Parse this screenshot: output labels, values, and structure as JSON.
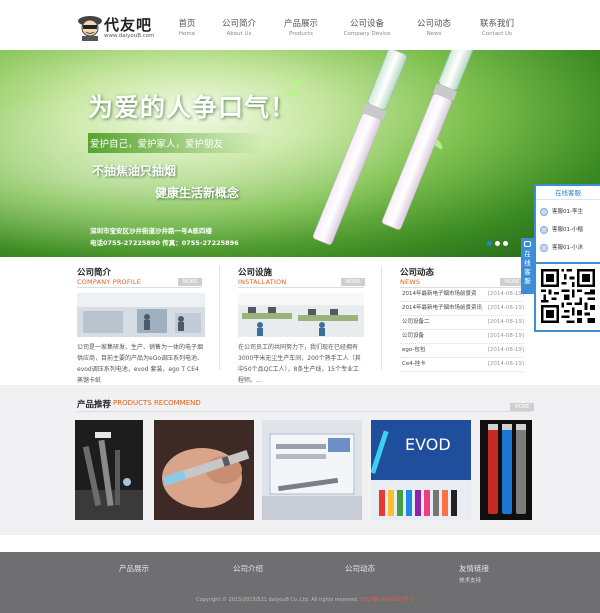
{
  "logo": {
    "name": "代友吧",
    "url": "www.daiyouB.com"
  },
  "nav": [
    {
      "cn": "首页",
      "en": "Home"
    },
    {
      "cn": "公司简介",
      "en": "About Us"
    },
    {
      "cn": "产品展示",
      "en": "Products"
    },
    {
      "cn": "公司设备",
      "en": "Company Device"
    },
    {
      "cn": "公司动态",
      "en": "News"
    },
    {
      "cn": "联系我们",
      "en": "Contact Us"
    }
  ],
  "banner": {
    "slogan": "为爱的人争口气！",
    "sub1": "爱护自己，爱护家人，爱护朋友",
    "sub2": "不抽焦油只抽烟",
    "sub3": "健康生活新概念",
    "address": "深圳市宝安区沙井街道沙井路一号A栋四楼",
    "phone": "电话0755-27225890  传真：0755-27225896"
  },
  "about": {
    "title": "公司简介",
    "subtitle": "COMPANY PROFILE",
    "more": "MORE",
    "text": "公司是一家集研发、生产、销售为一体的电子烟供应商，目前主要的产品为eGo调压系列电池、evod调压系列电池，evod 套装，ego T CE4 蒸馏卡纸"
  },
  "facilities": {
    "title": "公司设施",
    "subtitle": "INSTALLATION",
    "more": "MORE",
    "text": "在公司员工的共同努力下，我们现在已经拥有3000平米无尘生产车间，200个熟手工人（其中50个品QC工人），8条生产线，15个专业工程师。..."
  },
  "news": {
    "title": "公司动态",
    "subtitle": "NEWS",
    "more": "MORE",
    "items": [
      {
        "title": "2014年最新电子烟市场前景资",
        "date": "[2014-08-19]"
      },
      {
        "title": "2014年最新电子烟市场前景资讯",
        "date": "[2014-08-19]"
      },
      {
        "title": "公司设备二",
        "date": "[2014-08-19]"
      },
      {
        "title": "公司设备",
        "date": "[2014-08-19]"
      },
      {
        "title": "ego-包包",
        "date": "[2014-08-19]"
      },
      {
        "title": "Ce4-挂卡",
        "date": "[2014-08-19]"
      }
    ]
  },
  "products": {
    "title": "产品推荐",
    "subtitle": "PRODUCTS RECOMMEND",
    "more": "MORE",
    "evod_label": "EVOD"
  },
  "footer": {
    "links": [
      "产品展示",
      "公司介绍",
      "公司动态",
      "友情链接"
    ],
    "sublink": "技术支持",
    "copyright": "Copyright © 2015/2015/521 daiyouB Co.,Ltd. All rights reserved.",
    "icp": "粤ICP备14054310号-1"
  },
  "side": {
    "title": "在线客服",
    "agents": [
      "客服01-李生",
      "客服01-小楷",
      "客服01-小沐"
    ],
    "tab": "在线客服"
  },
  "colors": {
    "accent": "#e05f1a",
    "brand_blue": "#3c8fd6",
    "footer_bg": "#6f6f71",
    "banner_green": "#5aa83a"
  }
}
